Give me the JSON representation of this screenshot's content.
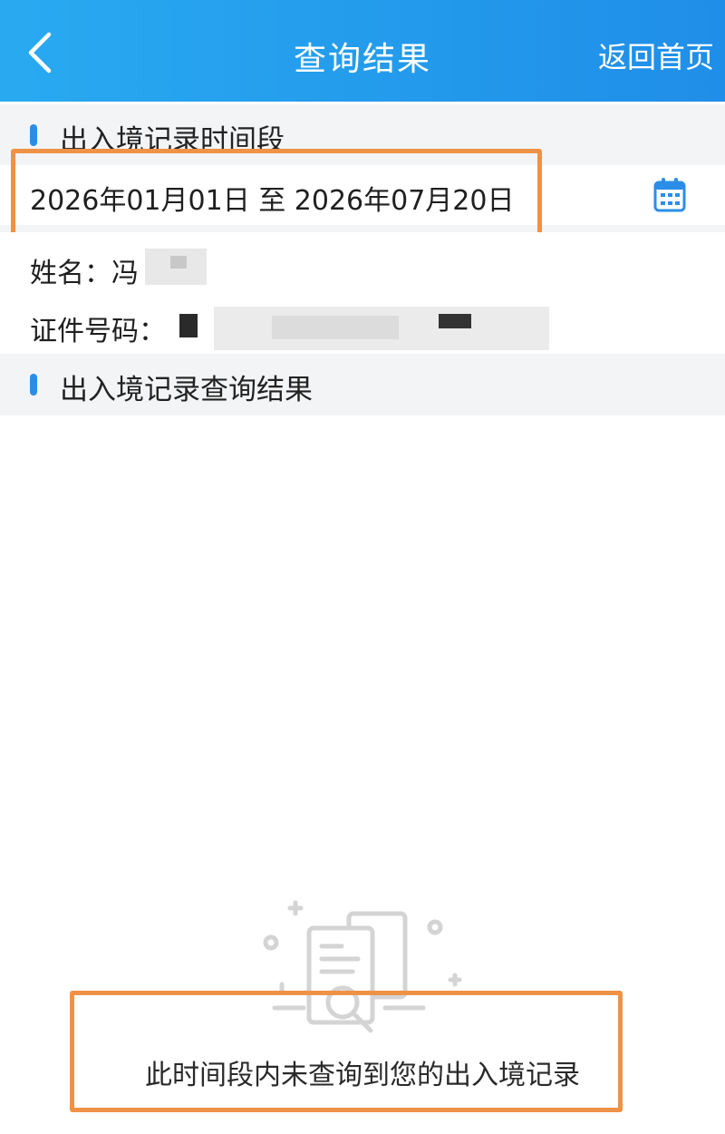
{
  "header": {
    "title": "查询结果",
    "home_link": "返回首页",
    "back_icon": "chevron-left-icon"
  },
  "period_section": {
    "heading": "出入境记录时间段",
    "date_range": "2026年01月01日 至 2026年07月20日",
    "calendar_icon": "calendar-icon"
  },
  "person": {
    "name_label": "姓名：",
    "name_value": "冯",
    "id_label": "证件号码："
  },
  "results_section": {
    "heading": "出入境记录查询结果",
    "empty_message": "此时间段内未查询到您的出入境记录",
    "empty_icon": "document-search-icon"
  },
  "colors": {
    "header_start": "#29aaf0",
    "header_end": "#1f8ee8",
    "accent": "#2a8ee8",
    "highlight_box": "#ee9247"
  }
}
